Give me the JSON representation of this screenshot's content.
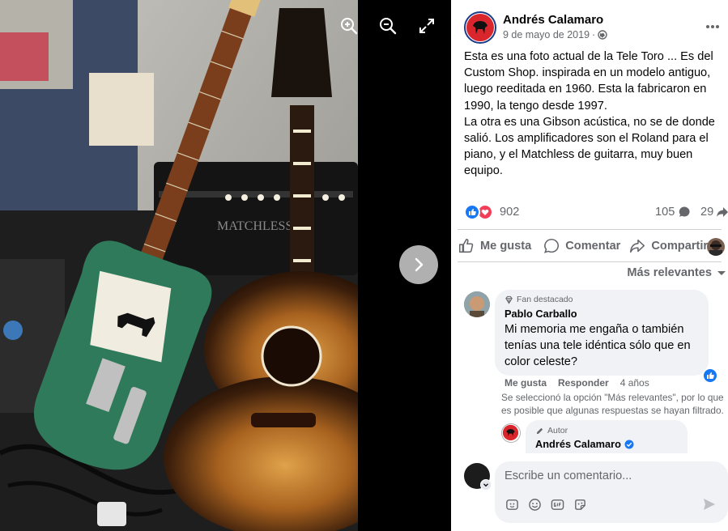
{
  "viewer": {
    "tools": [
      {
        "icon": "zoom-in-icon"
      },
      {
        "icon": "zoom-out-icon"
      },
      {
        "icon": "fullscreen-icon"
      }
    ],
    "next_icon": "chevron-right-icon"
  },
  "post": {
    "author": "Andrés Calamaro",
    "date": "9 de mayo de 2019",
    "separator": "·",
    "audience_icon": "globe-icon",
    "more_icon": "more-dots-icon",
    "paragraphs": [
      "Esta es una foto actual de la Tele Toro ... Es del Custom Shop. inspirada en un modelo antiguo, luego reeditada en 1960. Esta la fabricaron en 1990, la tengo desde 1997.",
      "La otra es una Gibson acústica, no se de donde salió. Los amplificadores son el Roland para el piano, y el Matchless de guitarra, muy buen equipo."
    ],
    "reactions": {
      "count": "902",
      "types": [
        "like",
        "love"
      ]
    },
    "comments_count": "105",
    "shares_count": "29",
    "colors": {
      "like": "#1877f2",
      "love": "#f33e58",
      "muted": "#65676b"
    }
  },
  "actions": {
    "like": "Me gusta",
    "comment": "Comentar",
    "share": "Compartir"
  },
  "sort_label": "Más relevantes",
  "comment": {
    "badge": "Fan destacado",
    "author": "Pablo Carballo",
    "text": "Mi memoria me engaña o también tenías una tele idéntica sólo que en color celeste?",
    "like_label": "Me gusta",
    "reply_label": "Responder",
    "time": "4 años",
    "filter_note": "Se seleccionó la opción \"Más relevantes\", por lo que es posible que algunas respuestas se hayan filtrado."
  },
  "reply": {
    "badge": "Autor",
    "author": "Andrés Calamaro"
  },
  "composer": {
    "placeholder": "Escribe un comentario...",
    "tools": [
      "sticker-icon",
      "emoji-icon",
      "gif-icon",
      "sticker-face-icon"
    ],
    "send_icon": "send-icon"
  },
  "photo_text": {
    "amp_brand": "MATCHLESS"
  }
}
